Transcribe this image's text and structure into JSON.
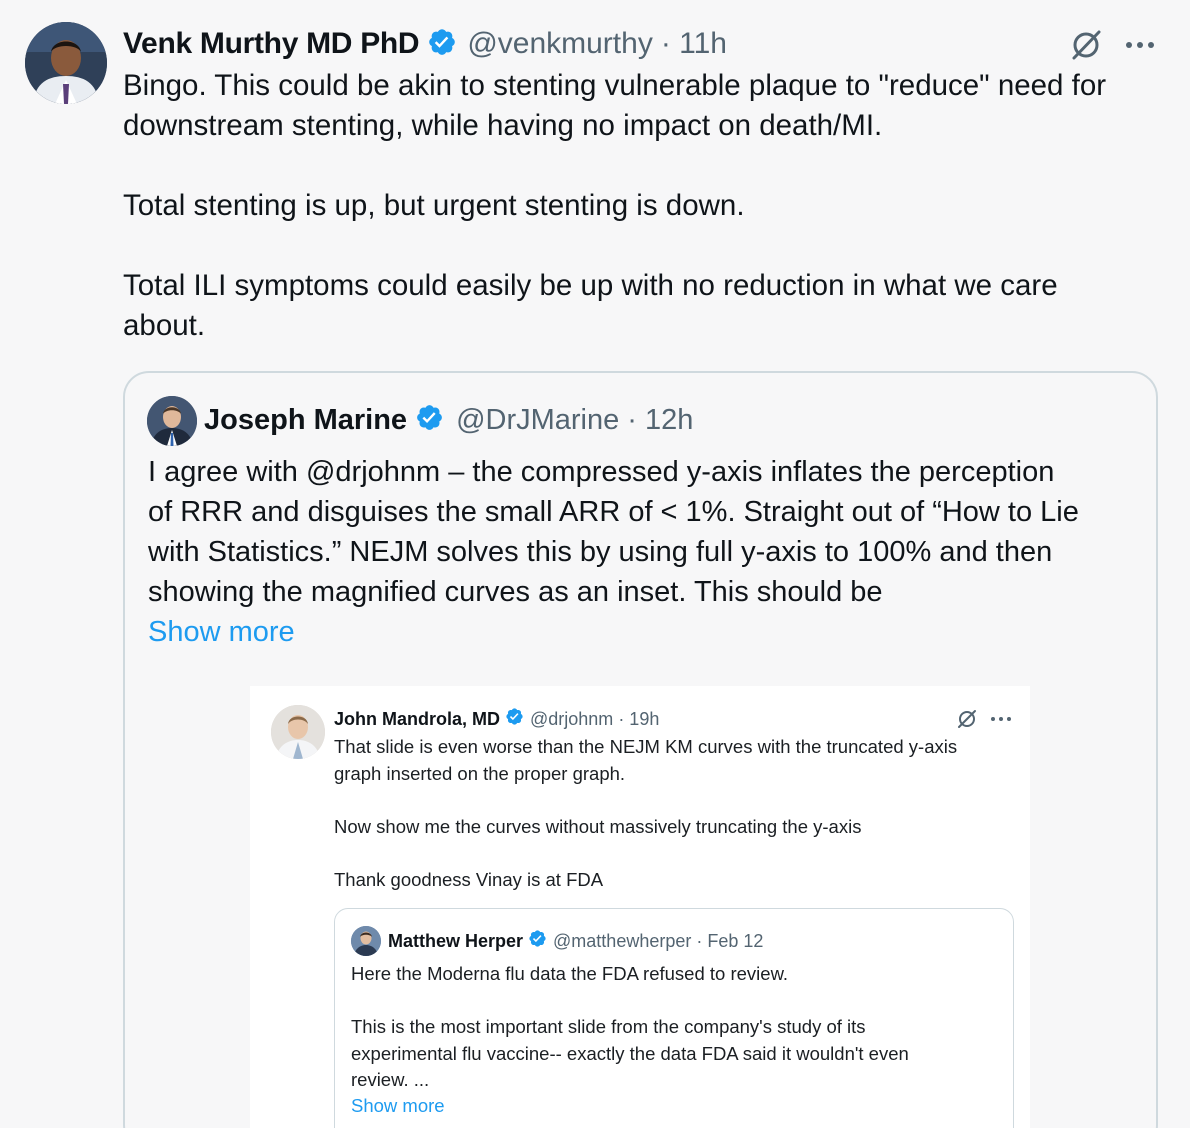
{
  "main_tweet": {
    "author_name": "Venk Murthy MD PhD",
    "handle": "@venkmurthy",
    "time": "· 11h",
    "body_lines": [
      "Bingo. This could be akin to stenting vulnerable plaque to \"reduce\" need for",
      "downstream stenting, while having no impact on death/MI.",
      "Total stenting is up, but urgent stenting is down.",
      "Total ILI symptoms could easily be up with no reduction in what we care",
      "about."
    ],
    "grok_icon": "grok-icon",
    "more_icon": "more-icon"
  },
  "quoted_tweet": {
    "author_name": "Joseph Marine",
    "handle": "@DrJMarine",
    "time": "· 12h",
    "body_lines": [
      "I agree with @drjohnm  – the compressed y-axis inflates the perception",
      "of RRR and disguises the small ARR of < 1%. Straight out of “How to Lie",
      "with Statistics.” NEJM solves this by using full y-axis to 100% and then",
      "showing the magnified curves as an inset. This should be"
    ],
    "show_more": "Show more"
  },
  "embedded_tweet": {
    "author_name": "John Mandrola, MD",
    "handle": "@drjohnm",
    "time": "· 19h",
    "body_lines": [
      "That slide is even worse than the NEJM KM curves with the truncated y-axis",
      "graph inserted on the proper graph.",
      "Now show me the curves without massively truncating the y-axis",
      "Thank goodness Vinay is at FDA"
    ],
    "inner_quote": {
      "author_name": "Matthew Herper",
      "handle": "@matthewherper",
      "time": "· Feb 12",
      "body_lines": [
        "Here the Moderna flu data the FDA refused to review.",
        "This is the most important slide from the company's study of its",
        "experimental flu vaccine-- exactly the data FDA said it wouldn't even",
        "review. ..."
      ],
      "show_more": "Show more"
    }
  },
  "colors": {
    "background": "#f7f7f8",
    "verified_blue": "#1d9bf0",
    "secondary_text": "#536471",
    "border": "#cfd9de"
  }
}
